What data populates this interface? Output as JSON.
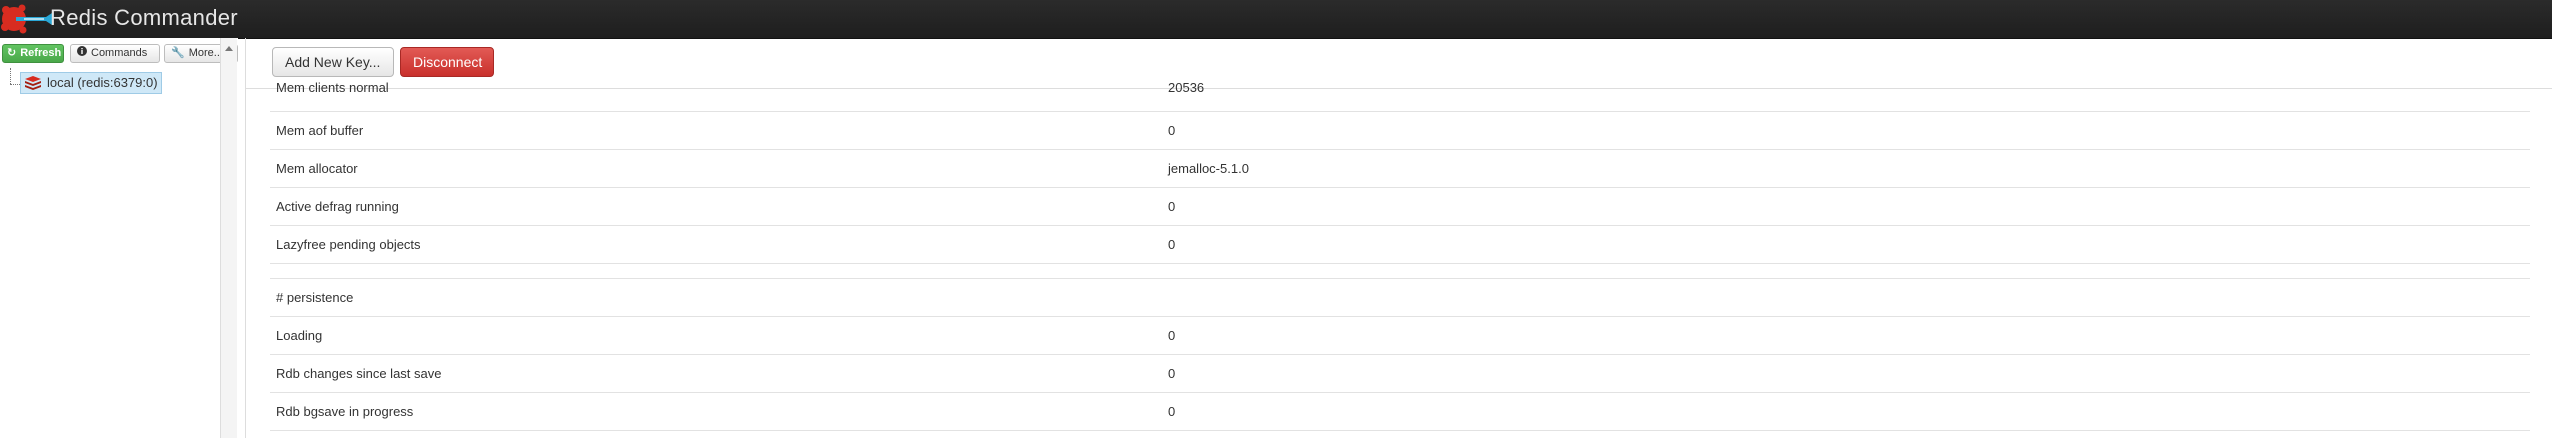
{
  "app": {
    "title": "Redis Commander",
    "brand_color": "#d82c20"
  },
  "sidebar": {
    "refresh_label": "Refresh",
    "commands_label": "Commands",
    "more_label": "More...",
    "icons": {
      "refresh": "refresh-icon",
      "commands": "info-icon",
      "more": "wrench-icon",
      "caret": "caret-down-icon"
    },
    "tree": {
      "node_label": "local (redis:6379:0)"
    }
  },
  "toolbar": {
    "add_key_label": "Add New Key...",
    "disconnect_label": "Disconnect"
  },
  "info_rows": [
    {
      "key": "Mem clients normal",
      "value": "20536"
    },
    {
      "key": "Mem aof buffer",
      "value": "0"
    },
    {
      "key": "Mem allocator",
      "value": "jemalloc-5.1.0"
    },
    {
      "key": "Active defrag running",
      "value": "0"
    },
    {
      "key": "Lazyfree pending objects",
      "value": "0"
    },
    {
      "key": "",
      "value": ""
    },
    {
      "key": "# persistence",
      "value": ""
    },
    {
      "key": "Loading",
      "value": "0"
    },
    {
      "key": "Rdb changes since last save",
      "value": "0"
    },
    {
      "key": "Rdb bgsave in progress",
      "value": "0"
    }
  ]
}
